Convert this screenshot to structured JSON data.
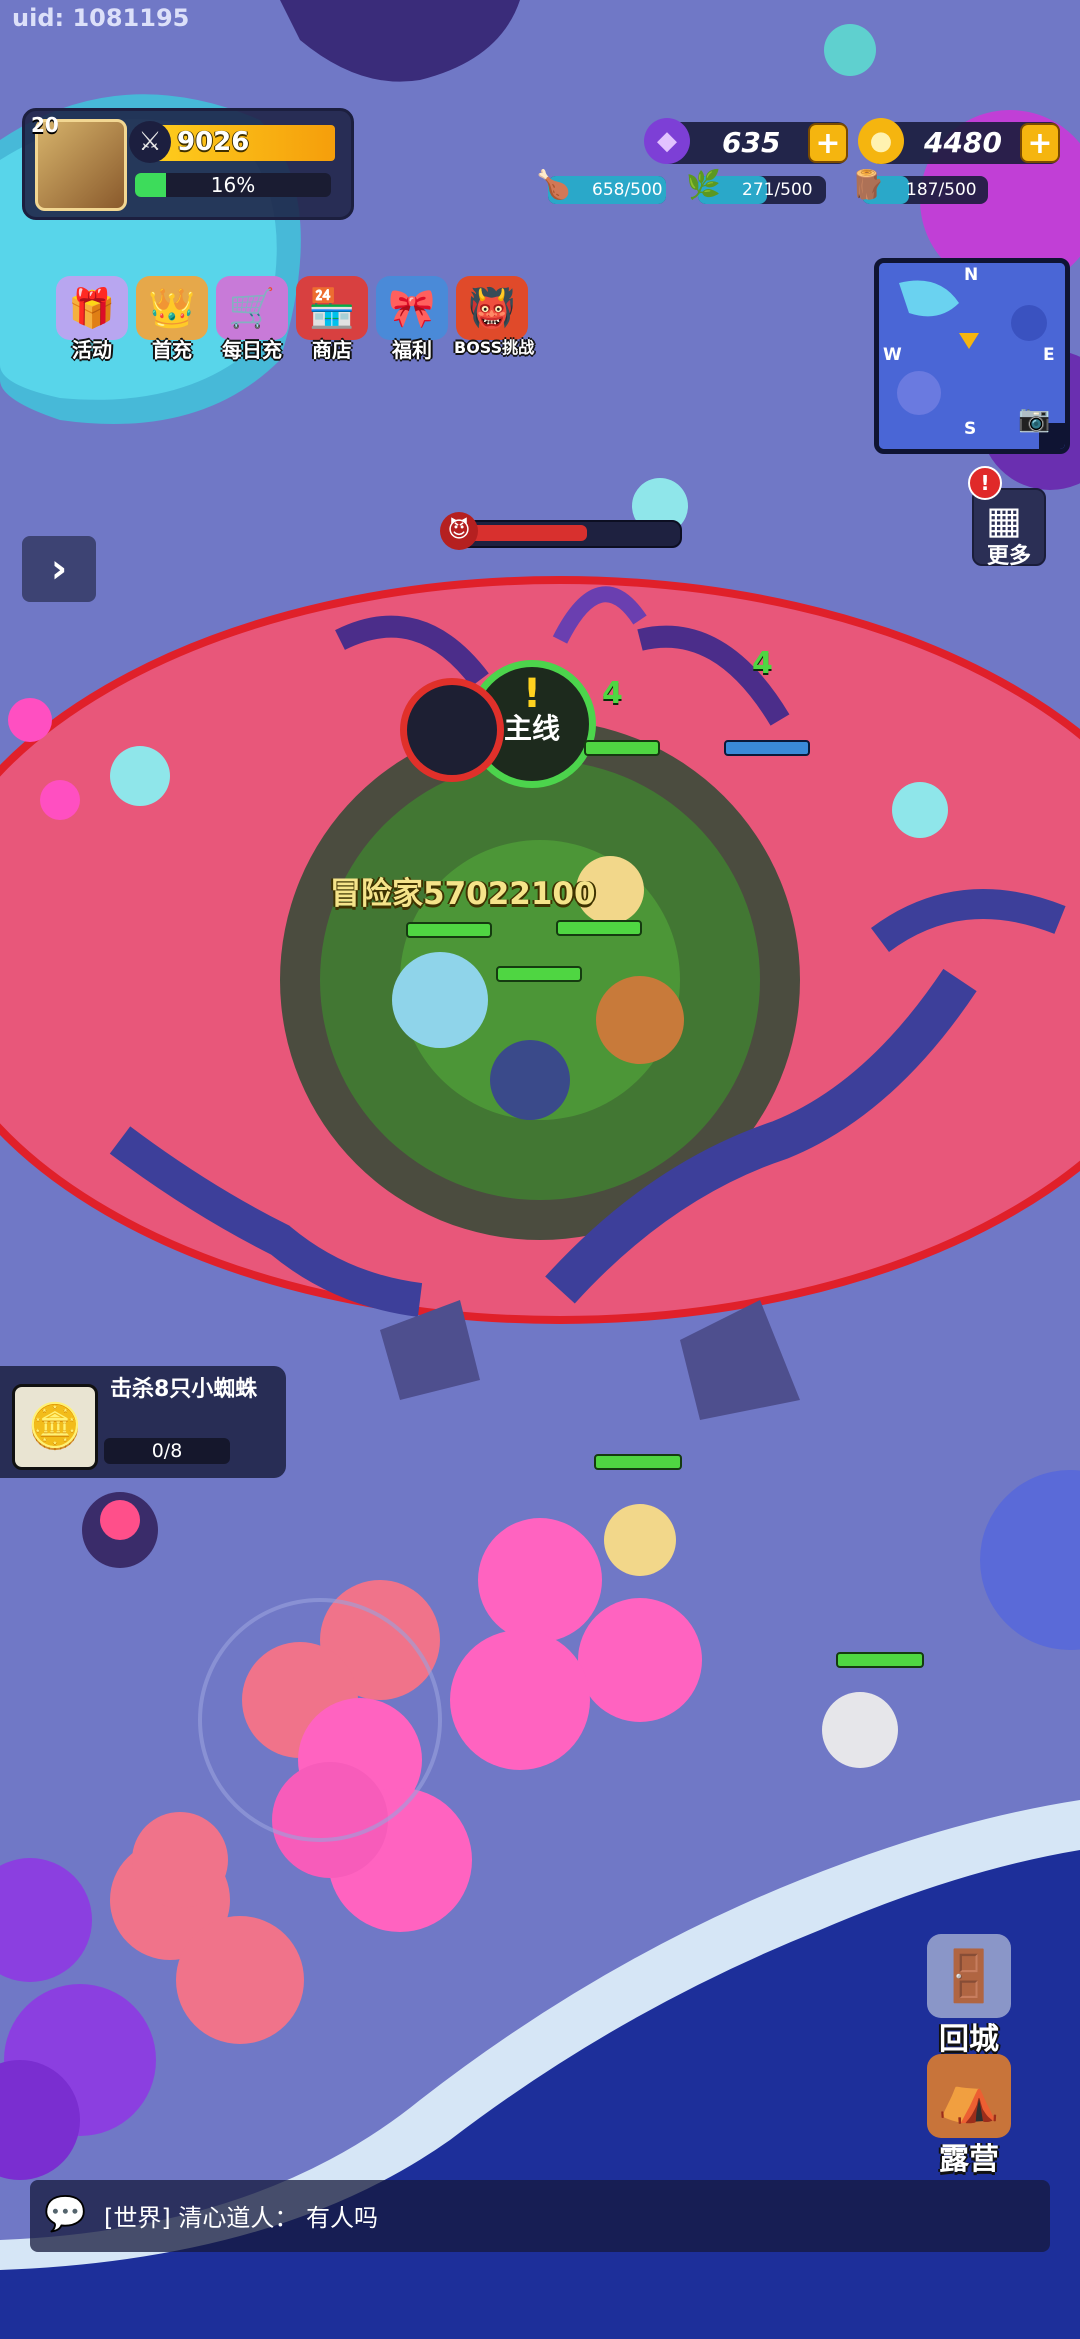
{
  "uid": "uid: 1081195",
  "player": {
    "level": "20",
    "power": "9026",
    "exp_percent": "16%",
    "exp_fraction": 0.16
  },
  "currency": {
    "gems": "635",
    "gold": "4480",
    "plus_symbol": "+"
  },
  "resources": [
    {
      "name": "meat",
      "icon": "meat-icon",
      "text": "658/500",
      "fraction": 1.0,
      "color": "#2aa8c9"
    },
    {
      "name": "herb",
      "icon": "leaf-icon",
      "text": "271/500",
      "fraction": 0.54,
      "color": "#2aa8c9"
    },
    {
      "name": "wood",
      "icon": "wood-icon",
      "text": "187/500",
      "fraction": 0.37,
      "color": "#2aa8c9"
    }
  ],
  "menu": [
    {
      "label": "活动",
      "icon": "chest-icon"
    },
    {
      "label": "首充",
      "icon": "king-icon"
    },
    {
      "label": "每日充",
      "icon": "cart-icon"
    },
    {
      "label": "商店",
      "icon": "shop-icon"
    },
    {
      "label": "福利",
      "icon": "gift-icon"
    },
    {
      "label": "BOSS挑战",
      "icon": "boss-icon"
    }
  ],
  "minimap": {
    "n": "N",
    "s": "S",
    "w": "W",
    "e": "E"
  },
  "more_button": {
    "label": "更多",
    "alert": "!"
  },
  "side_arrow": "›",
  "boss": {
    "hp_fraction": 0.58
  },
  "battle": {
    "player_name": "冒险家57022100",
    "quest_label": "主线",
    "quest_mark": "!",
    "damage_numbers": [
      "4",
      "4"
    ]
  },
  "task": {
    "title": "击杀8只小蜘蛛",
    "progress": "0/8"
  },
  "right_buttons": [
    {
      "label": "回城",
      "icon": "portal-icon"
    },
    {
      "label": "露营",
      "icon": "tent-icon"
    }
  ],
  "chat": {
    "channel": "[世界]",
    "sender": "清心道人：",
    "message": "有人吗"
  },
  "colors": {
    "arena": "#e8577a",
    "ring": "#e0202a",
    "ground": "#6f78c4",
    "sea": "#1a2a8a"
  }
}
